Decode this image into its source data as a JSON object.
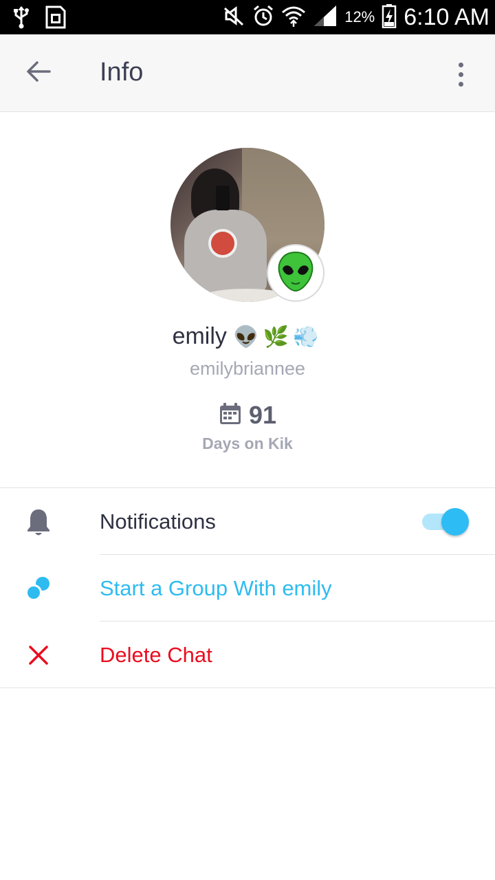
{
  "status_bar": {
    "battery_percent": "12%",
    "time": "6:10 AM",
    "icons": [
      "usb-icon",
      "sim-icon",
      "mute-icon",
      "alarm-icon",
      "wifi-icon",
      "signal-icon",
      "battery-charging-icon"
    ]
  },
  "app_bar": {
    "title": "Info",
    "back_icon": "arrow-left-icon",
    "more_icon": "more-vertical-icon"
  },
  "profile": {
    "display_name": "emily",
    "name_emojis": "👽🌿💨",
    "username": "emilybriannee",
    "badge_icon": "alien-icon",
    "days_count": "91",
    "days_label": "Days on Kik",
    "days_icon": "calendar-icon"
  },
  "options": {
    "notifications": {
      "label": "Notifications",
      "icon": "bell-icon",
      "toggle_on": true
    },
    "start_group": {
      "label": "Start a Group With emily",
      "icon": "group-bubbles-icon",
      "color": "#2ebcf0"
    },
    "delete_chat": {
      "label": "Delete Chat",
      "icon": "close-x-icon",
      "color": "#ea0d1f"
    }
  },
  "colors": {
    "accent": "#2ebcf5",
    "danger": "#ea0d1f",
    "text_primary": "#2f3142",
    "text_secondary": "#a5a7b4"
  }
}
